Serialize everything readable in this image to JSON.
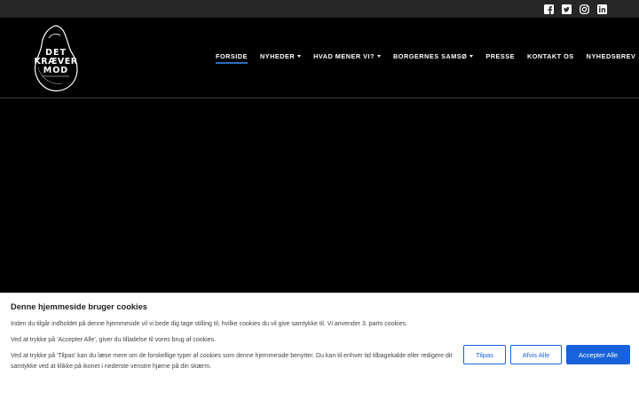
{
  "social": {
    "facebook": "facebook-icon",
    "twitter": "twitter-icon",
    "instagram": "instagram-icon",
    "linkedin": "linkedin-icon"
  },
  "logo": {
    "line1": "DET",
    "line2": "KRÆVER",
    "line3": "MOD"
  },
  "nav": {
    "items": [
      {
        "label": "FORSIDE",
        "active": true
      },
      {
        "label": "NYHEDER",
        "dropdown": true
      },
      {
        "label": "HVAD MENER VI?",
        "dropdown": true
      },
      {
        "label": "BORGERNES SAMSØ",
        "dropdown": true
      },
      {
        "label": "PRESSE"
      },
      {
        "label": "KONTAKT OS"
      },
      {
        "label": "NYHEDSBREV"
      }
    ]
  },
  "cookie": {
    "title": "Denne hjemmeside bruger cookies",
    "p1": "Inden du tilgår indholdet på denne hjemmeside vil vi bede dig tage stilling til, hvilke cookies du vil give samtykke til. Vi anvender 3. parts cookies.",
    "p2": "Ved at trykke på 'Accepter Alle',  giver du tilladelse til vores brug af cookies.",
    "p3": "Ved at trykke på 'Tilpas' kan du læse mere om de forskellige typer af cookies som denne hjemmeside benytter. Du kan til enhver tid tilbagekalde eller redigere dit samtykke ved at klikke på ikonet i nederste venstre hjørne på din skærm.",
    "btn_customize": "Tilpas",
    "btn_reject": "Afvis Alle",
    "btn_accept": "Accepter Alle"
  },
  "colors": {
    "accent": "#1863dc",
    "nav_underline": "#2a6ebd",
    "topbar": "#262626"
  }
}
